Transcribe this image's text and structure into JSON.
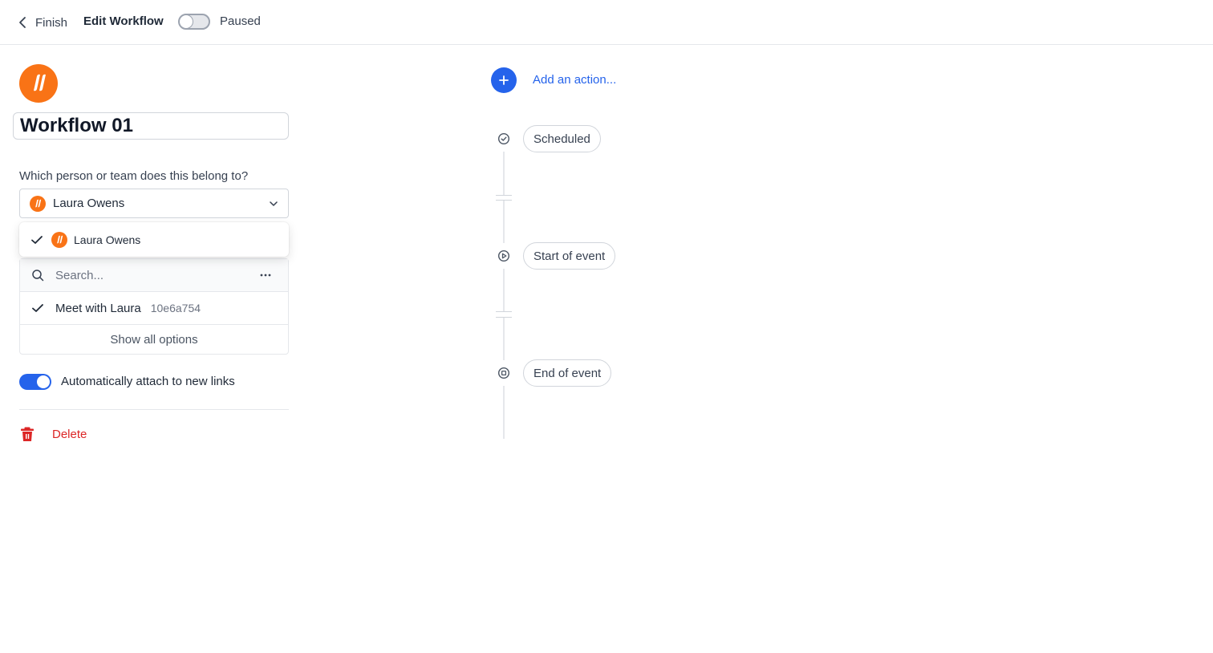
{
  "header": {
    "back_label": "Finish",
    "title": "Edit Workflow",
    "status_label": "Paused",
    "status_enabled": false
  },
  "workflow": {
    "name": "Workflow 01",
    "logo_icon": "brand-logo-icon",
    "brand_color": "#f97316"
  },
  "owner": {
    "question": "Which person or team does this belong to?",
    "selected": "Laura Owens",
    "options": [
      {
        "label": "Laura Owens",
        "checked": true
      }
    ]
  },
  "links": {
    "search_placeholder": "Search...",
    "items": [
      {
        "name": "Meet with Laura",
        "id": "10e6a754",
        "checked": true
      }
    ],
    "show_all_label": "Show all options"
  },
  "auto_attach": {
    "label": "Automatically attach to new links",
    "enabled": true
  },
  "delete_label": "Delete",
  "timeline": {
    "add_action_label": "Add an action...",
    "steps": [
      {
        "label": "Scheduled",
        "icon": "check-circle-icon"
      },
      {
        "label": "Start of event",
        "icon": "play-circle-icon"
      },
      {
        "label": "End of event",
        "icon": "stop-circle-icon"
      }
    ]
  },
  "colors": {
    "accent": "#2563eb",
    "danger": "#dc2626",
    "brand": "#f97316"
  }
}
